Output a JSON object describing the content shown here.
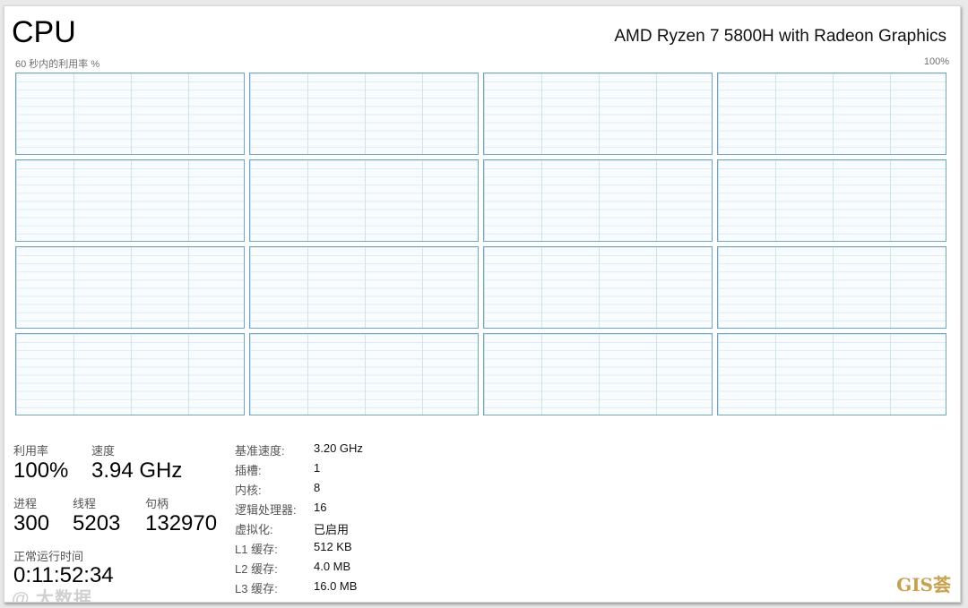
{
  "header": {
    "title": "CPU",
    "cpu_model": "AMD Ryzen 7 5800H with Radeon Graphics"
  },
  "graph": {
    "caption": "60 秒内的利用率 %",
    "max_label": "100%",
    "core_count": 16
  },
  "stats": {
    "utilization_label": "利用率",
    "utilization_value": "100%",
    "speed_label": "速度",
    "speed_value": "3.94 GHz",
    "processes_label": "进程",
    "processes_value": "300",
    "threads_label": "线程",
    "threads_value": "5203",
    "handles_label": "句柄",
    "handles_value": "132970",
    "uptime_label": "正常运行时间",
    "uptime_value": "0:11:52:34"
  },
  "specs": [
    {
      "label": "基准速度:",
      "value": "3.20 GHz"
    },
    {
      "label": "插槽:",
      "value": "1"
    },
    {
      "label": "内核:",
      "value": "8"
    },
    {
      "label": "逻辑处理器:",
      "value": "16"
    },
    {
      "label": "虚拟化:",
      "value": "已启用"
    },
    {
      "label": "L1 缓存:",
      "value": "512 KB"
    },
    {
      "label": "L2 缓存:",
      "value": "4.0 MB"
    },
    {
      "label": "L3 缓存:",
      "value": "16.0 MB"
    }
  ],
  "watermarks": {
    "left": "@ 大数据",
    "right": "GIS荟"
  },
  "colors": {
    "graph_border": "#6fa6c8",
    "graph_grid": "#cfe3ef"
  }
}
